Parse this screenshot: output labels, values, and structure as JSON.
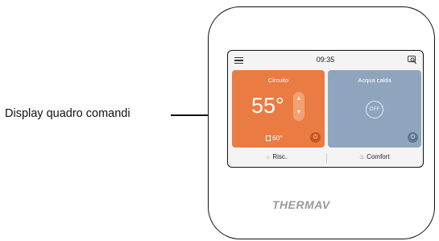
{
  "callout": {
    "label": "Display quadro comandi"
  },
  "screen": {
    "time": "09:35",
    "heating": {
      "title": "Circuito",
      "temperature": "55°",
      "setpoint": "60°",
      "power_icon": "power-icon"
    },
    "water": {
      "title": "Acqua calda",
      "toggle": "OFF",
      "power_icon": "power-icon"
    },
    "bottom": {
      "mode_left": "Risc.",
      "mode_right": "Comfort"
    }
  },
  "brand": "THERMAV",
  "colors": {
    "heating_panel": "#ea7b42",
    "water_panel": "#8fa5be"
  }
}
